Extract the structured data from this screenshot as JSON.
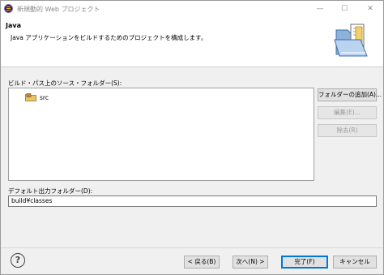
{
  "window": {
    "title": "新規動的 Web プロジェクト",
    "min_glyph": "—",
    "max_glyph": "☐",
    "close_glyph": "✕"
  },
  "banner": {
    "title": "Java",
    "description": "Java アプリケーションをビルドするためのプロジェクトを構成します。",
    "icon": "open-folder-icon"
  },
  "source_folders": {
    "label": "ビルド・パス上のソース・フォルダー(S):",
    "items": [
      {
        "label": "src",
        "icon": "package-folder-icon"
      }
    ]
  },
  "side_buttons": {
    "add_folder": "フォルダーの追加(A)...",
    "edit": "編集(E)...",
    "remove": "除去(R)"
  },
  "output": {
    "label": "デフォルト出力フォルダー(D):",
    "value": "build¥classes"
  },
  "footer": {
    "help_glyph": "?",
    "back": "< 戻る(B)",
    "next": "次へ(N) >",
    "finish": "完了(F)",
    "cancel": "キャンセル"
  }
}
